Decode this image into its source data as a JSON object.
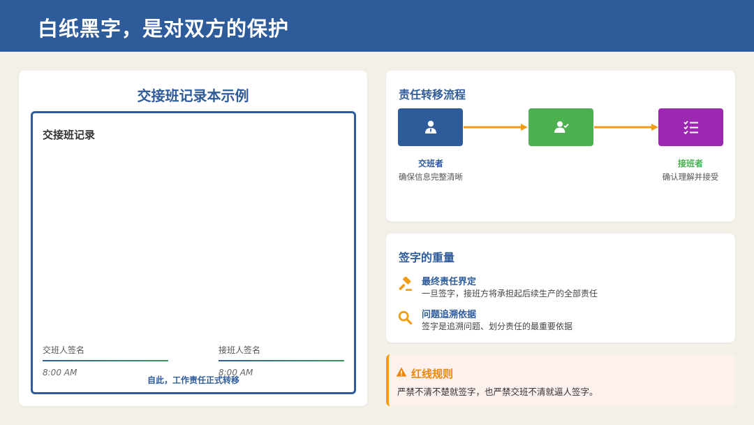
{
  "header": {
    "title": "白纸黑字，是对双方的保护"
  },
  "record_example": {
    "title": "交接班记录本示例",
    "record_title": "交接班记录",
    "handover_label": "交班人签名",
    "handover_time": "8:00 AM",
    "takeover_label": "接班人签名",
    "takeover_time": "8:00 AM",
    "note": "自此，工作责任正式转移"
  },
  "flow": {
    "title": "责任转移流程",
    "nodes": [
      {
        "icon": "person-icon",
        "color": "#2e5b9a"
      },
      {
        "icon": "person-check-icon",
        "color": "#4caf50"
      },
      {
        "icon": "checklist-icon",
        "color": "#9c27b0"
      }
    ],
    "arrow_color": "#f39c12",
    "captions": [
      {
        "role": "交班者",
        "desc": "确保信息完整清晰"
      },
      {
        "role": "接班者",
        "desc": "确认理解并接受"
      }
    ]
  },
  "signature_weight": {
    "title": "签字的重量",
    "items": [
      {
        "icon": "gavel-icon",
        "heading": "最终责任界定",
        "desc": "一旦签字，接班方将承担起后续生产的全部责任"
      },
      {
        "icon": "magnifier-icon",
        "heading": "问题追溯依据",
        "desc": "签字是追溯问题、划分责任的最重要依据"
      }
    ]
  },
  "red_line": {
    "icon": "warning-icon",
    "title": "红线规则",
    "text": "严禁不清不楚就签字，也严禁交班不清就逼人签字。"
  },
  "colors": {
    "header": "#2e5b9a",
    "page_background": "#f3f0e8",
    "accent_orange": "#f39c12",
    "green": "#4caf50",
    "purple": "#9c27b0"
  }
}
